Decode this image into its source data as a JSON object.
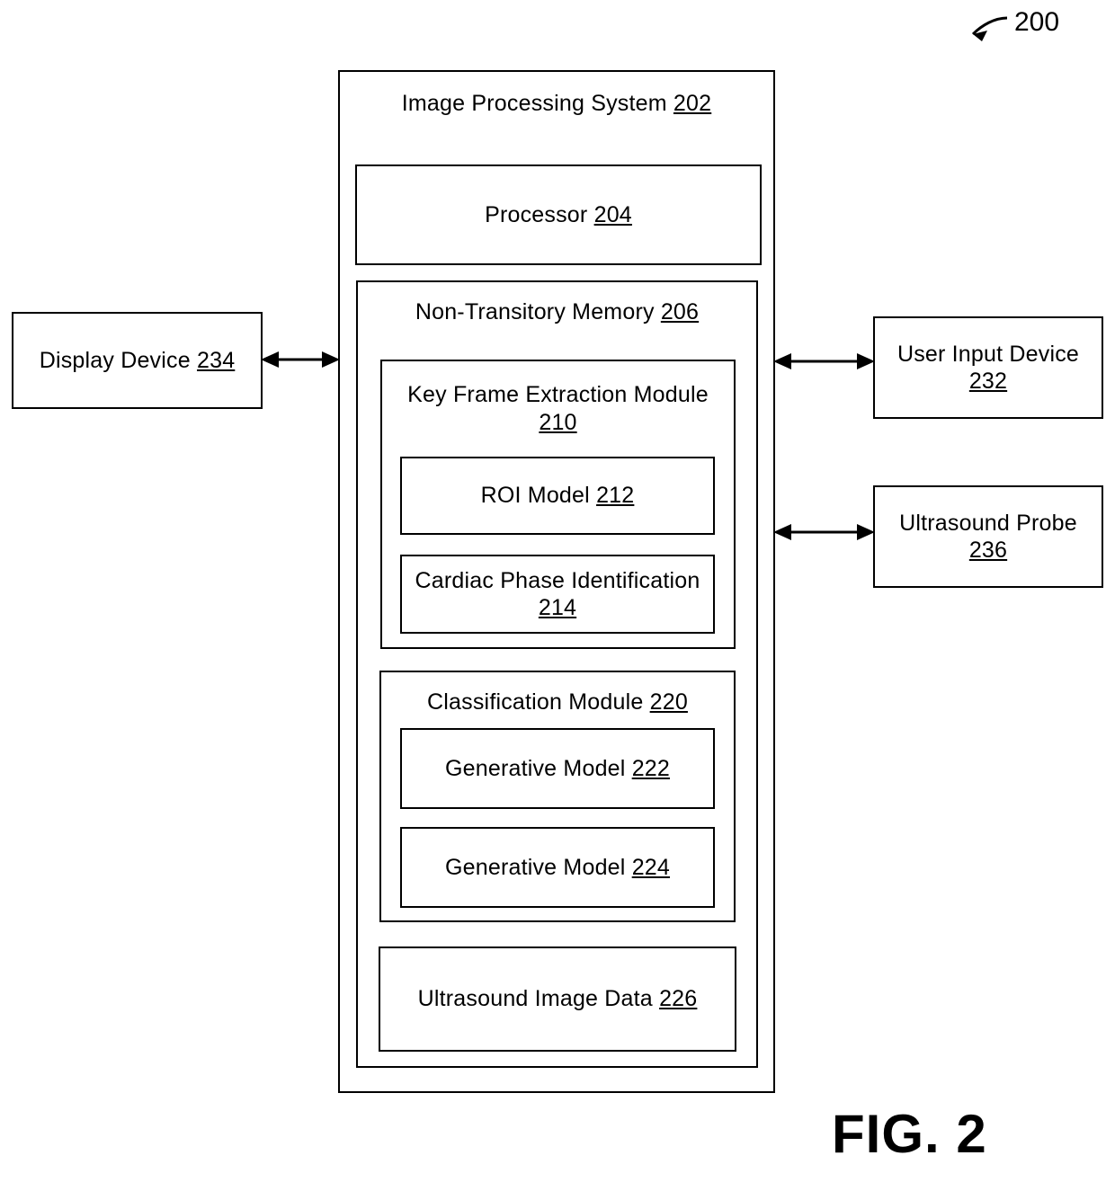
{
  "figure": {
    "label": "FIG. 2",
    "callout_number": "200"
  },
  "system": {
    "title": "Image Processing System",
    "ref": "202",
    "processor": {
      "title": "Processor",
      "ref": "204"
    },
    "memory": {
      "title": "Non-Transitory Memory",
      "ref": "206",
      "modules": [
        {
          "title": "Key Frame Extraction Module",
          "ref": "210",
          "children": [
            {
              "title": "ROI Model",
              "ref": "212"
            },
            {
              "title": "Cardiac Phase Identification",
              "ref": "214"
            }
          ]
        },
        {
          "title": "Classification Module",
          "ref": "220",
          "children": [
            {
              "title": "Generative Model",
              "ref": "222"
            },
            {
              "title": "Generative Model",
              "ref": "224"
            }
          ]
        }
      ],
      "data_store": {
        "title": "Ultrasound Image Data",
        "ref": "226"
      }
    }
  },
  "peripherals": {
    "display_device": {
      "title": "Display Device",
      "ref": "234"
    },
    "user_input_device": {
      "title": "User Input Device",
      "ref": "232"
    },
    "ultrasound_probe": {
      "title": "Ultrasound Probe",
      "ref": "236"
    }
  },
  "style": {
    "line_color": "#000000",
    "background": "#ffffff"
  }
}
